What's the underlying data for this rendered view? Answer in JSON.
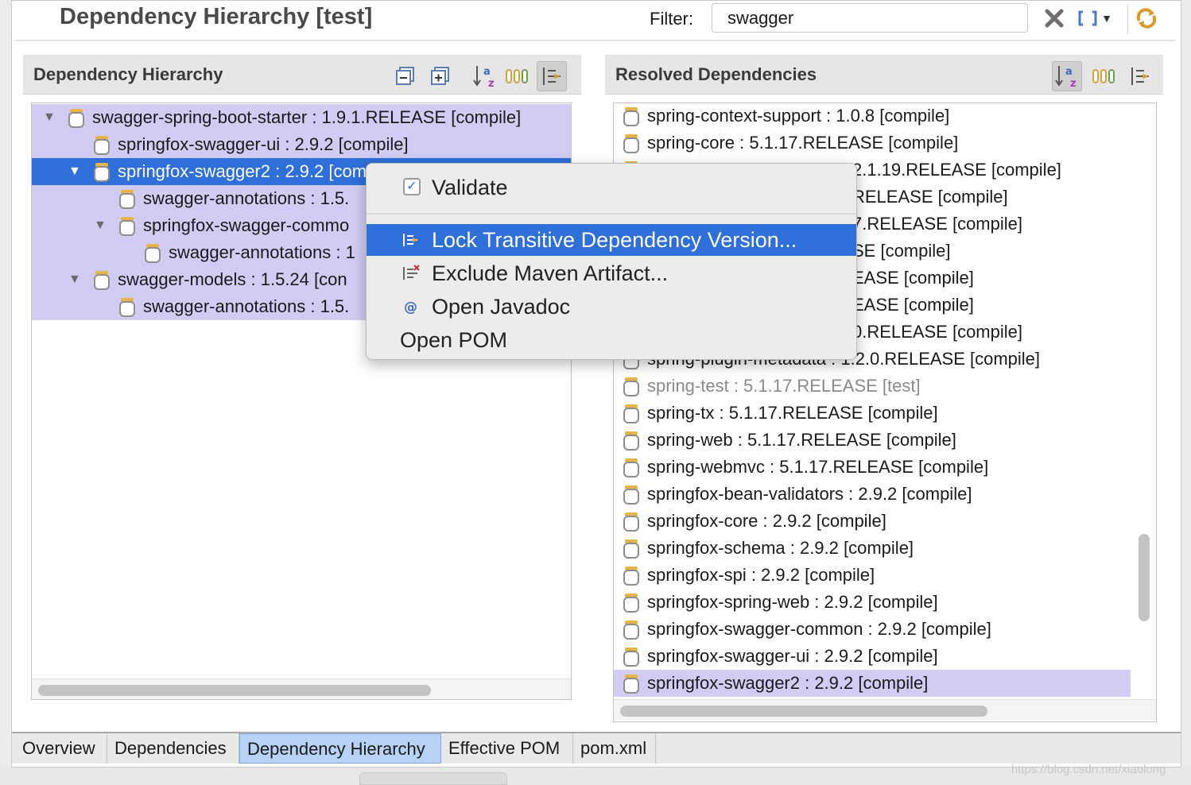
{
  "editor": {
    "title": "Dependency Hierarchy [test]",
    "filter_label": "Filter:",
    "filter_value": "swagger",
    "toolbar_icons": [
      "clear-filter-icon",
      "select-scope-icon",
      "dropdown-arrow-icon",
      "refresh-icon"
    ]
  },
  "left_panel": {
    "title": "Dependency Hierarchy",
    "toolbar_icons": [
      "collapse-all-icon",
      "expand-all-icon",
      "sort-az-icon",
      "show-group-id-icon",
      "filter-matching-icon"
    ],
    "rows": [
      {
        "label": "swagger-spring-boot-starter : 1.9.1.RELEASE [compile]",
        "depth": 0,
        "expanded": true,
        "state": "match"
      },
      {
        "label": "springfox-swagger-ui : 2.9.2 [compile]",
        "depth": 1,
        "expanded": null,
        "state": "match"
      },
      {
        "label": "springfox-swagger2 : 2.9.2 [compile]",
        "depth": 1,
        "expanded": true,
        "state": "selected"
      },
      {
        "label": "swagger-annotations : 1.5.",
        "depth": 2,
        "expanded": null,
        "state": "match"
      },
      {
        "label": "springfox-swagger-commo",
        "depth": 2,
        "expanded": true,
        "state": "match"
      },
      {
        "label": "swagger-annotations : 1",
        "depth": 3,
        "expanded": null,
        "state": "match"
      },
      {
        "label": "swagger-models : 1.5.24 [con",
        "depth": 1,
        "expanded": true,
        "state": "match"
      },
      {
        "label": "swagger-annotations : 1.5.",
        "depth": 2,
        "expanded": null,
        "state": "match"
      }
    ]
  },
  "right_panel": {
    "title": "Resolved Dependencies",
    "toolbar_icons": [
      "sort-az-icon",
      "show-group-id-icon",
      "filter-matching-icon"
    ],
    "rows": [
      {
        "label": "spring-context-support : 1.0.8 [compile]",
        "state": ""
      },
      {
        "label": "spring-core : 5.1.17.RELEASE [compile]",
        "state": ""
      },
      {
        "label": "2.1.19.RELEASE [compile]",
        "state": "hidden"
      },
      {
        "label": "RELEASE [compile]",
        "state": "hidden"
      },
      {
        "label": "7.RELEASE [compile]",
        "state": "hidden"
      },
      {
        "label": "SE [compile]",
        "state": "hidden"
      },
      {
        "label": "EASE [compile]",
        "state": "hidden"
      },
      {
        "label": "EASE [compile]",
        "state": "hidden"
      },
      {
        "label": "0.RELEASE [compile]",
        "state": "hidden"
      },
      {
        "label": "spring-plugin-metadata : 1.2.0.RELEASE [compile]",
        "state": ""
      },
      {
        "label": "spring-test : 5.1.17.RELEASE [test]",
        "state": "test"
      },
      {
        "label": "spring-tx : 5.1.17.RELEASE [compile]",
        "state": ""
      },
      {
        "label": "spring-web : 5.1.17.RELEASE [compile]",
        "state": ""
      },
      {
        "label": "spring-webmvc : 5.1.17.RELEASE [compile]",
        "state": ""
      },
      {
        "label": "springfox-bean-validators : 2.9.2 [compile]",
        "state": ""
      },
      {
        "label": "springfox-core : 2.9.2 [compile]",
        "state": ""
      },
      {
        "label": "springfox-schema : 2.9.2 [compile]",
        "state": ""
      },
      {
        "label": "springfox-spi : 2.9.2 [compile]",
        "state": ""
      },
      {
        "label": "springfox-spring-web : 2.9.2 [compile]",
        "state": ""
      },
      {
        "label": "springfox-swagger-common : 2.9.2 [compile]",
        "state": ""
      },
      {
        "label": "springfox-swagger-ui : 2.9.2 [compile]",
        "state": ""
      },
      {
        "label": "springfox-swagger2 : 2.9.2 [compile]",
        "state": "match"
      }
    ]
  },
  "context_menu": {
    "validate_label": "Validate",
    "validate_checked": true,
    "items": [
      {
        "label": "Lock Transitive Dependency Version...",
        "icon": "lock-version-icon",
        "highlighted": true
      },
      {
        "label": "Exclude Maven Artifact...",
        "icon": "exclude-artifact-icon",
        "highlighted": false
      },
      {
        "label": "Open Javadoc",
        "icon": "javadoc-icon",
        "highlighted": false
      },
      {
        "label": "Open POM",
        "icon": "",
        "highlighted": false
      }
    ]
  },
  "tabs": [
    {
      "label": "Overview",
      "active": false
    },
    {
      "label": "Dependencies",
      "active": false
    },
    {
      "label": "Dependency Hierarchy",
      "active": true
    },
    {
      "label": "Effective POM",
      "active": false
    },
    {
      "label": "pom.xml",
      "active": false
    }
  ],
  "watermark": "https://blog.csdn.net/xiaolong",
  "colors": {
    "selection": "#2f6fd9",
    "match_highlight": "#d0ccf3",
    "jar_lid": "#e6b447"
  }
}
